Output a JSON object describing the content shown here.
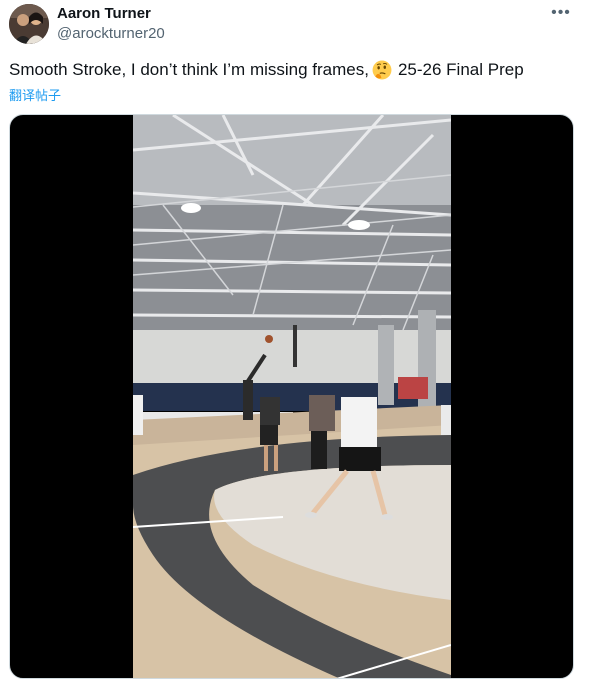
{
  "user": {
    "display_name": "Aaron Turner",
    "handle": "@arockturner20"
  },
  "tweet": {
    "text": "Smooth Stroke, I don’t think I’m missing frames,",
    "emoji": "thinking-face-icon",
    "text_after": "25-26 Final Prep",
    "translate_label": "翻译帖子"
  },
  "toolbar": {
    "more_label": "•••"
  },
  "media": {
    "type": "video"
  },
  "colors": {
    "link": "#1d9bf0",
    "muted": "#536471",
    "text": "#0f1419"
  }
}
